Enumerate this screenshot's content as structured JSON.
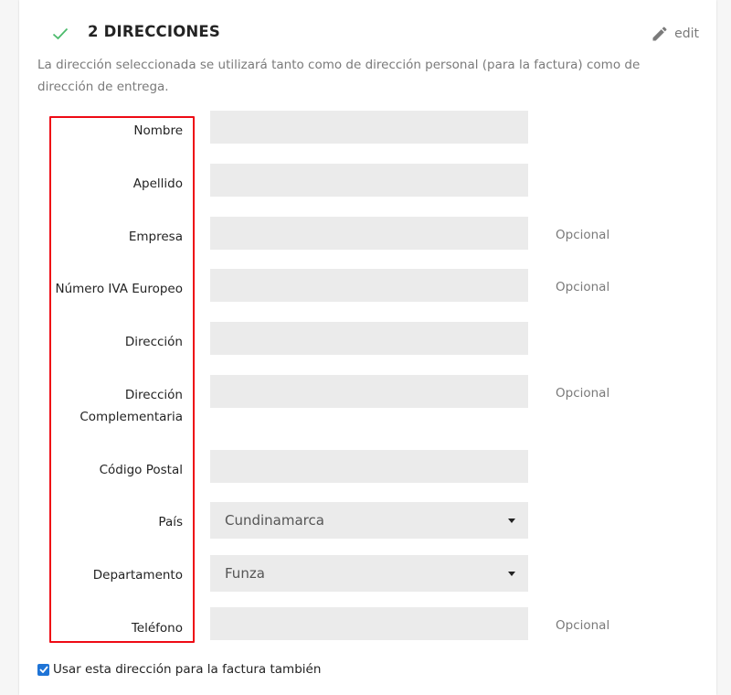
{
  "step": {
    "title": "2 DIRECCIONES",
    "edit_label": "edit",
    "intro": "La dirección seleccionada se utilizará tanto como de dirección personal (para la factura) como de dirección de entrega."
  },
  "form": {
    "fields": [
      {
        "label": "Nombre",
        "type": "text",
        "value": "",
        "optional": ""
      },
      {
        "label": "Apellido",
        "type": "text",
        "value": "",
        "optional": ""
      },
      {
        "label": "Empresa",
        "type": "text",
        "value": "",
        "optional": "Opcional"
      },
      {
        "label": "Número IVA Europeo",
        "type": "text",
        "value": "",
        "optional": "Opcional"
      },
      {
        "label": "Dirección",
        "type": "text",
        "value": "",
        "optional": ""
      },
      {
        "label": "Dirección Complementaria",
        "type": "text",
        "value": "",
        "optional": "Opcional"
      },
      {
        "label": "Código Postal",
        "type": "text",
        "value": "",
        "optional": ""
      },
      {
        "label": "País",
        "type": "select",
        "value": "Cundinamarca",
        "optional": ""
      },
      {
        "label": "Departamento",
        "type": "select",
        "value": "Funza",
        "optional": ""
      },
      {
        "label": "Teléfono",
        "type": "text",
        "value": "",
        "optional": "Opcional"
      }
    ],
    "invoice_checkbox": {
      "label": "Usar esta dirección para la factura también",
      "checked": true
    }
  },
  "colors": {
    "check": "#4cbb6c",
    "highlight": "#ee0a15",
    "input_bg": "#ebebeb",
    "checkbox": "#1f74d6"
  },
  "icons": {
    "done": "check-icon",
    "edit": "pencil-icon",
    "dropdown": "caret-down-icon"
  }
}
